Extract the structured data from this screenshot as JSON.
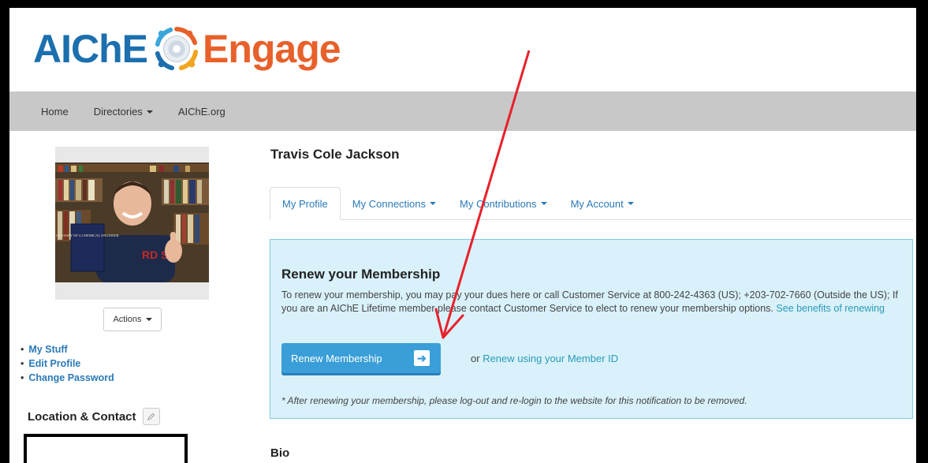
{
  "logo": {
    "part1": "AIChE",
    "part2": "Engage"
  },
  "nav": {
    "items": [
      {
        "label": "Home",
        "dropdown": false
      },
      {
        "label": "Directories",
        "dropdown": true
      },
      {
        "label": "AIChE.org",
        "dropdown": false
      }
    ]
  },
  "sidebar": {
    "actions_label": "Actions",
    "links": [
      "My Stuff",
      "Edit Profile",
      "Change Password"
    ],
    "location_title": "Location & Contact",
    "photo_book_text": "ODYSSEY OF A CHEMICAL ENGINEER"
  },
  "profile": {
    "name": "Travis Cole Jackson"
  },
  "tabs": [
    {
      "label": "My Profile",
      "active": true,
      "dropdown": false
    },
    {
      "label": "My Connections",
      "active": false,
      "dropdown": true
    },
    {
      "label": "My Contributions",
      "active": false,
      "dropdown": true
    },
    {
      "label": "My Account",
      "active": false,
      "dropdown": true
    }
  ],
  "renew": {
    "title": "Renew your Membership",
    "text": "To renew your membership, you may pay your dues here or call Customer Service at 800-242-4363 (US); +203-702-7660 (Outside the US); If you are an AIChE Lifetime member please contact Customer Service to elect to renew your membership options.",
    "benefits_link": "See benefits of renewing",
    "button_label": "Renew Membership",
    "or_text": "or",
    "member_id_link": "Renew using your Member ID",
    "note": "* After renewing your membership, please log-out and re-login to the website for this notification to be removed."
  },
  "bio_title": "Bio",
  "colors": {
    "brand_blue": "#1c6fae",
    "brand_orange": "#e8612a",
    "link": "#2a7ab8",
    "alert_bg": "#d9f1fa",
    "button": "#3a9fd8",
    "annotation": "#e8202a"
  }
}
